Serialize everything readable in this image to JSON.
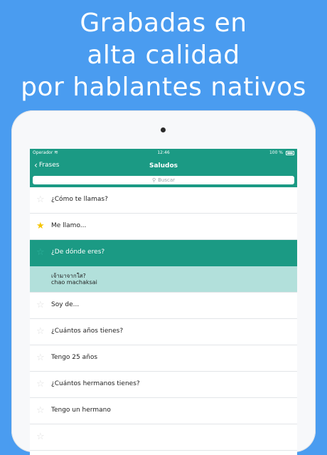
{
  "headline": {
    "line1": "Grabadas en",
    "line2": "alta calidad",
    "line3": "por hablantes nativos"
  },
  "statusbar": {
    "carrier": "Operador",
    "time": "12:46",
    "battery": "100 %"
  },
  "navbar": {
    "back_label": "Frases",
    "title": "Saludos"
  },
  "search": {
    "placeholder": "Buscar"
  },
  "colors": {
    "background": "#4a9cf0",
    "accent": "#1b9a84",
    "detail": "#b2e0db",
    "star_active": "#f5c400"
  },
  "phrases": [
    {
      "label": "¿Cómo te llamas?",
      "favorite": false
    },
    {
      "label": "Me llamo...",
      "favorite": true
    },
    {
      "label": "¿De dónde eres?",
      "favorite": false,
      "selected": true
    },
    {
      "label": "Soy de...",
      "favorite": false
    },
    {
      "label": "¿Cuántos años tienes?",
      "favorite": false
    },
    {
      "label": "Tengo 25 años",
      "favorite": false
    },
    {
      "label": "¿Cuántos hermanos tienes?",
      "favorite": false
    },
    {
      "label": "Tengo un hermano",
      "favorite": false
    }
  ],
  "expanded": {
    "native": "เจ้ามาจากใส?",
    "romanization": "chao machaksai"
  }
}
